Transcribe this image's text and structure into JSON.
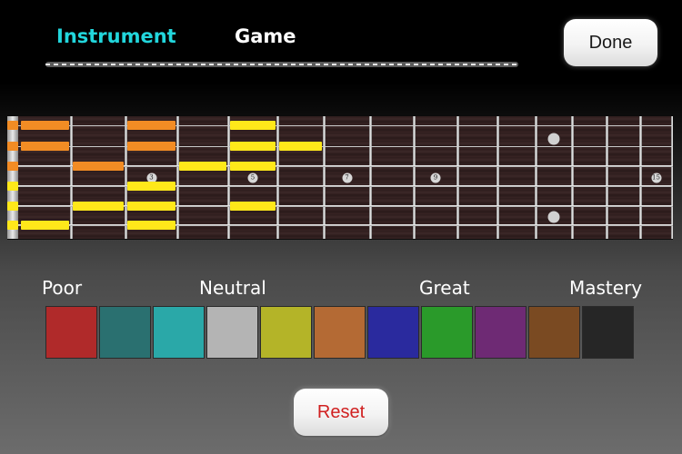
{
  "tabs": {
    "instrument": {
      "label": "Instrument",
      "color": "#22d6dc",
      "selected": true
    },
    "game": {
      "label": "Game",
      "color": "#ffffff"
    }
  },
  "buttons": {
    "done": "Done",
    "reset": "Reset",
    "reset_color": "#d02020"
  },
  "fretboard": {
    "strings": 6,
    "frets": 15,
    "inlays": [
      {
        "fret": 3,
        "text": "3"
      },
      {
        "fret": 5,
        "text": "5"
      },
      {
        "fret": 7,
        "text": "7"
      },
      {
        "fret": 9,
        "text": "9"
      },
      {
        "fret": 12,
        "text": ""
      },
      {
        "fret": 15,
        "text": "15"
      }
    ],
    "notes": [
      {
        "string": 1,
        "fret": 1,
        "color": "#f28c24"
      },
      {
        "string": 1,
        "fret": 3,
        "color": "#f28c24"
      },
      {
        "string": 1,
        "fret": 5,
        "color": "#ffe81a"
      },
      {
        "string": 2,
        "fret": 1,
        "color": "#f28c24"
      },
      {
        "string": 2,
        "fret": 3,
        "color": "#f28c24"
      },
      {
        "string": 2,
        "fret": 5,
        "color": "#ffe81a"
      },
      {
        "string": 2,
        "fret": 6,
        "color": "#ffe81a"
      },
      {
        "string": 3,
        "fret": 2,
        "color": "#f28c24"
      },
      {
        "string": 3,
        "fret": 4,
        "color": "#ffe81a"
      },
      {
        "string": 3,
        "fret": 5,
        "color": "#ffe81a"
      },
      {
        "string": 4,
        "fret": 3,
        "color": "#ffe81a"
      },
      {
        "string": 5,
        "fret": 2,
        "color": "#ffe81a"
      },
      {
        "string": 5,
        "fret": 3,
        "color": "#ffe81a"
      },
      {
        "string": 5,
        "fret": 5,
        "color": "#ffe81a"
      },
      {
        "string": 6,
        "fret": 1,
        "color": "#ffe81a"
      },
      {
        "string": 6,
        "fret": 3,
        "color": "#ffe81a"
      }
    ],
    "open_markers": [
      {
        "string": 1,
        "color": "#f28c24"
      },
      {
        "string": 2,
        "color": "#f28c24"
      },
      {
        "string": 3,
        "color": "#f28c24"
      },
      {
        "string": 4,
        "color": "#ffe81a"
      },
      {
        "string": 5,
        "color": "#ffe81a"
      },
      {
        "string": 6,
        "color": "#ffe81a"
      }
    ]
  },
  "legend": {
    "labels": {
      "poor": "Poor",
      "neutral": "Neutral",
      "great": "Great",
      "mastery": "Mastery"
    },
    "colors": [
      "#b02a2a",
      "#2a7070",
      "#2aa8a8",
      "#b4b4b4",
      "#b4b428",
      "#b46a34",
      "#2a2a9e",
      "#2a9a2a",
      "#6e2a74",
      "#7a4a22",
      "#262626"
    ]
  }
}
